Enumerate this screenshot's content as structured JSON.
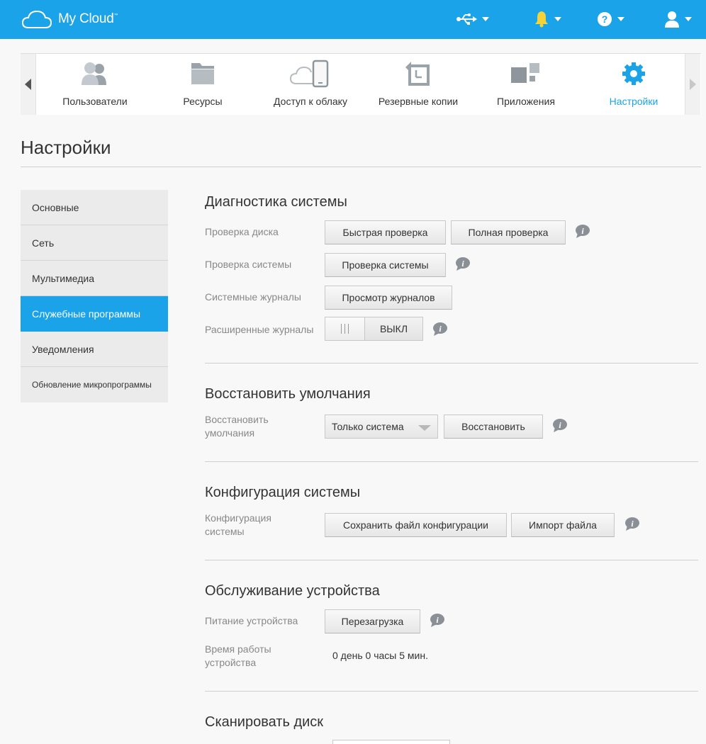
{
  "app": {
    "logo_text": "My Cloud",
    "logo_tm": "™"
  },
  "header": {
    "icons": [
      "usb-icon",
      "bell-icon",
      "help-icon",
      "user-icon"
    ],
    "colors": {
      "bar": "#1aa3e8",
      "bell": "#f4d23b"
    }
  },
  "nav": {
    "items": [
      {
        "label": "Пользователи",
        "icon": "users-icon"
      },
      {
        "label": "Ресурсы",
        "icon": "folder-icon"
      },
      {
        "label": "Доступ к облаку",
        "icon": "cloud-device-icon"
      },
      {
        "label": "Резервные копии",
        "icon": "backup-icon"
      },
      {
        "label": "Приложения",
        "icon": "apps-icon"
      },
      {
        "label": "Настройки",
        "icon": "settings-gear-icon",
        "active": true
      }
    ],
    "active_color": "#1aa3e8"
  },
  "page": {
    "title": "Настройки"
  },
  "sidebar": {
    "items": [
      {
        "label": "Основные"
      },
      {
        "label": "Сеть"
      },
      {
        "label": "Мультимедиа"
      },
      {
        "label": "Служебные программы",
        "active": true
      },
      {
        "label": "Уведомления"
      },
      {
        "label": "Обновление микропрограммы"
      }
    ]
  },
  "diagnostics": {
    "title": "Диагностика системы",
    "disk_check_label": "Проверка диска",
    "quick_check": "Быстрая проверка",
    "full_check": "Полная проверка",
    "system_check_label": "Проверка системы",
    "system_check_button": "Проверка системы",
    "system_logs_label": "Системные журналы",
    "view_logs": "Просмотр журналов",
    "extended_logs_label": "Расширенные журналы",
    "extended_logs_state": "ВЫКЛ"
  },
  "restore": {
    "title": "Восстановить умолчания",
    "label": "Восстановить умолчания",
    "select_value": "Только система",
    "button": "Восстановить"
  },
  "config": {
    "title": "Конфигурация системы",
    "label": "Конфигурация системы",
    "save_button": "Сохранить файл конфигурации",
    "import_button": "Импорт файла"
  },
  "maintenance": {
    "title": "Обслуживание устройства",
    "power_label": "Питание устройства",
    "reboot_button": "Перезагрузка",
    "uptime_label": "Время работы устройства",
    "uptime_value": "0 день 0 часы 5 мин."
  },
  "scan": {
    "title": "Сканировать диск"
  }
}
